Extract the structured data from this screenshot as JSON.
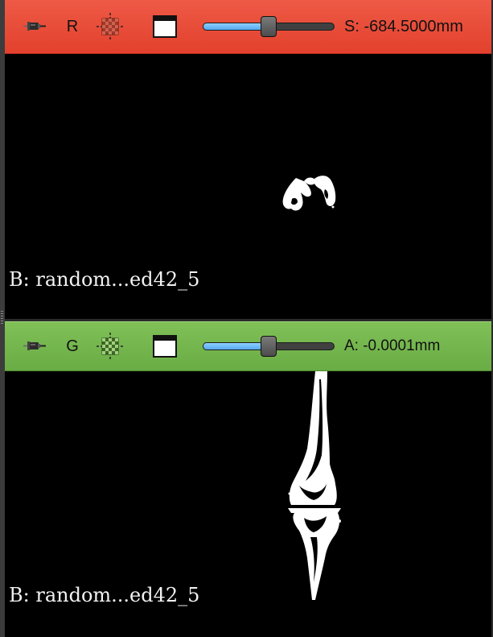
{
  "views": {
    "red": {
      "letter": "R",
      "offset_label": "S: -684.5000mm",
      "slider_value_fraction": 0.5,
      "corner_label": "B: random...ed42_5",
      "bar_color": "#e8493a"
    },
    "green": {
      "letter": "G",
      "offset_label": "A: -0.0001mm",
      "slider_value_fraction": 0.5,
      "corner_label": "B: random...ed42_5",
      "bar_color": "#72b44d"
    }
  },
  "icons": {
    "pin": "pin-icon",
    "layer": "layer-grid-icon",
    "window": "window-maximize-icon"
  },
  "colors": {
    "slider_fill": "#6bb9f5",
    "background": "#000000",
    "label_text": "#f2f2f2"
  }
}
